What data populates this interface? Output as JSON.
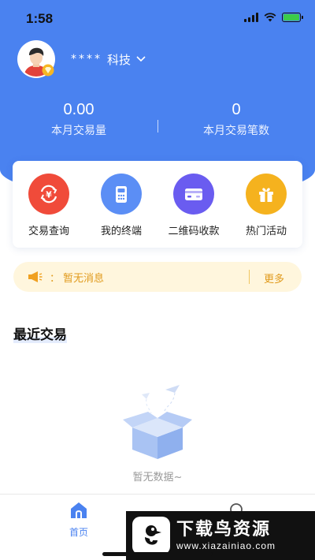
{
  "status_bar": {
    "time": "1:58"
  },
  "header": {
    "company_masked": "****",
    "company_suffix": "科技",
    "brand_color": "#4a82f0"
  },
  "stats": [
    {
      "value": "0.00",
      "label": "本月交易量"
    },
    {
      "value": "0",
      "label": "本月交易笔数"
    }
  ],
  "quick_actions": [
    {
      "label": "交易查询",
      "icon": "transaction-query-icon",
      "color": "#f04b3a"
    },
    {
      "label": "我的终端",
      "icon": "pos-terminal-icon",
      "color": "#5b8ef5"
    },
    {
      "label": "二维码收款",
      "icon": "qr-payment-card-icon",
      "color": "#6a5cf0"
    },
    {
      "label": "热门活动",
      "icon": "gift-icon",
      "color": "#f5b21e"
    }
  ],
  "notice": {
    "colon": "：",
    "text": "暂无消息",
    "more_label": "更多"
  },
  "recent": {
    "title": "最近交易",
    "empty_text": "暂无数据~"
  },
  "tabbar": {
    "home_label": "首页",
    "active_color": "#4a82f0"
  },
  "watermark": {
    "title": "下载鸟资源",
    "url": "www.xiazainiao.com"
  }
}
